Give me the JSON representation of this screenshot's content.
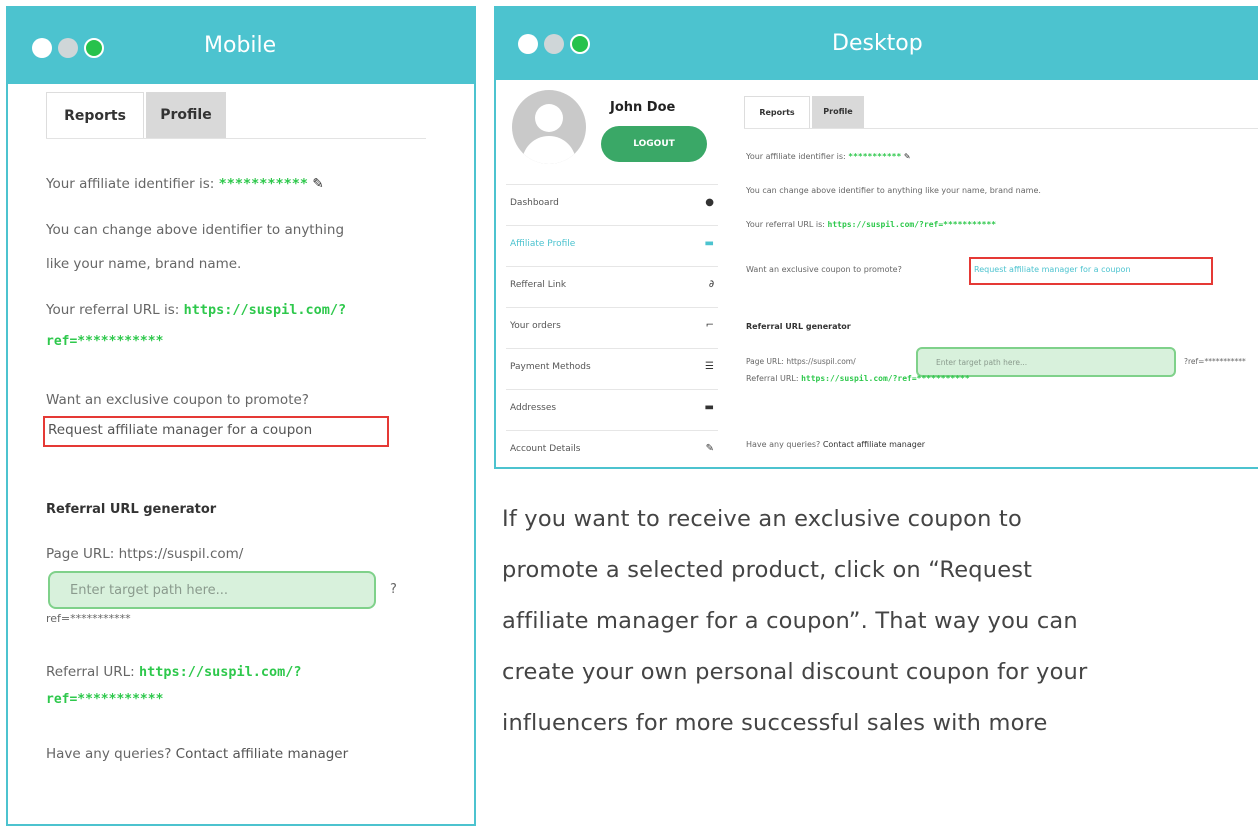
{
  "mobile": {
    "title": "Mobile",
    "tabs": [
      "Reports",
      "Profile"
    ],
    "identifier_label": "Your affiliate identifier is: ",
    "identifier_value": "***********",
    "change_text_1": "You can change above identifier to anything",
    "change_text_2": "like your name, brand name.",
    "referral_label": "Your referral URL is: ",
    "referral_url_1": "https://suspil.com/?",
    "referral_url_2": "ref=***********",
    "coupon_question": "Want an exclusive coupon to promote?",
    "coupon_link": "Request affiliate manager for a coupon",
    "generator_heading": "Referral URL generator",
    "page_url_label": "Page URL: https://suspil.com/",
    "input_placeholder": "Enter target path here...",
    "question_mark": "?",
    "ref_suffix": "ref=***********",
    "referral_out_label": "Referral URL: ",
    "referral_out_1": "https://suspil.com/?",
    "referral_out_2": "ref=***********",
    "queries_label": "Have any queries? ",
    "queries_link": "Contact affiliate manager"
  },
  "desktop": {
    "title": "Desktop",
    "user_name": "John Doe",
    "logout": "LOGOUT",
    "sidebar": [
      {
        "label": "Dashboard",
        "icon": "dashboard-icon",
        "glyph": "●"
      },
      {
        "label": "Affiliate Profile",
        "icon": "profile-icon",
        "glyph": "▬"
      },
      {
        "label": "Refferal Link",
        "icon": "link-icon",
        "glyph": "∂"
      },
      {
        "label": "Your orders",
        "icon": "orders-icon",
        "glyph": "⌐"
      },
      {
        "label": "Payment Methods",
        "icon": "payment-icon",
        "glyph": "☰"
      },
      {
        "label": "Addresses",
        "icon": "address-icon",
        "glyph": "▬"
      },
      {
        "label": "Account Details",
        "icon": "account-icon",
        "glyph": "✎"
      }
    ],
    "tabs": [
      "Reports",
      "Profile"
    ],
    "identifier_label": "Your affiliate identifier is: ",
    "identifier_value": "***********",
    "change_text": "You can change above identifier to anything like your name, brand name.",
    "referral_label": "Your referral URL is: ",
    "referral_url": "https://suspil.com/?ref=***********",
    "coupon_question": "Want an exclusive coupon to promote?",
    "coupon_link": "Request affiliate manager for a coupon",
    "generator_heading": "Referral URL generator",
    "page_url_label": "Page URL: https://suspil.com/",
    "input_placeholder": "Enter target path here...",
    "ref_suffix": "?ref=***********",
    "referral_out_label": "Referral URL: ",
    "referral_out": "https://suspil.com/?ref=***********",
    "queries_label": "Have any queries? ",
    "queries_link": "Contact affiliate manager"
  },
  "paragraph": [
    "If you want to receive an exclusive coupon to",
    "promote a selected product, click on “Request",
    "affiliate manager for a coupon”. That way you can",
    "create your own personal discount coupon for your",
    "influencers for more successful sales with more"
  ],
  "colors": {
    "accent": "#4cc3cf",
    "link_green": "#2ec84c",
    "highlight_red": "#e53935",
    "input_green": "#d8f1dc"
  }
}
